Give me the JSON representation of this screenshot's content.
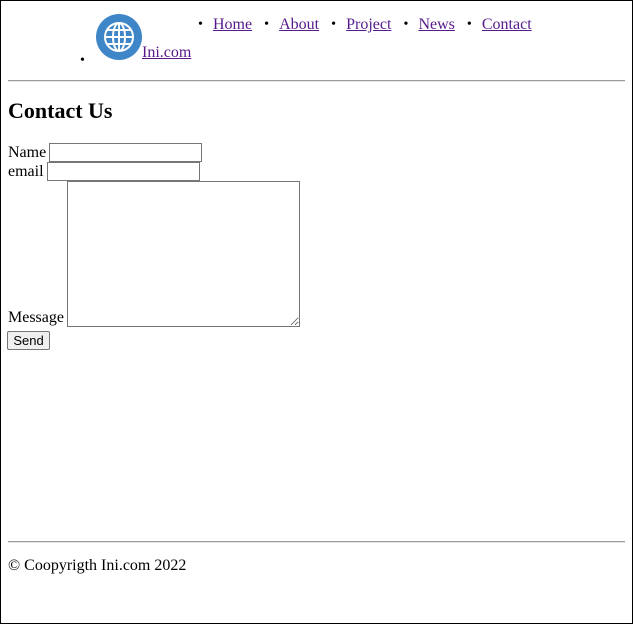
{
  "brand": {
    "name": "Ini.com",
    "icon": "globe-icon",
    "icon_color": "#3f86c8"
  },
  "nav": {
    "items": [
      {
        "label": "Home"
      },
      {
        "label": "About"
      },
      {
        "label": "Project"
      },
      {
        "label": "News"
      },
      {
        "label": "Contact"
      }
    ]
  },
  "main": {
    "title": "Contact Us",
    "form": {
      "name_label": "Name",
      "name_value": "",
      "email_label": "email",
      "email_value": "",
      "message_label": "Message",
      "message_value": "",
      "send_label": "Send"
    }
  },
  "footer": {
    "text": "© Coopyrigth Ini.com 2022"
  }
}
